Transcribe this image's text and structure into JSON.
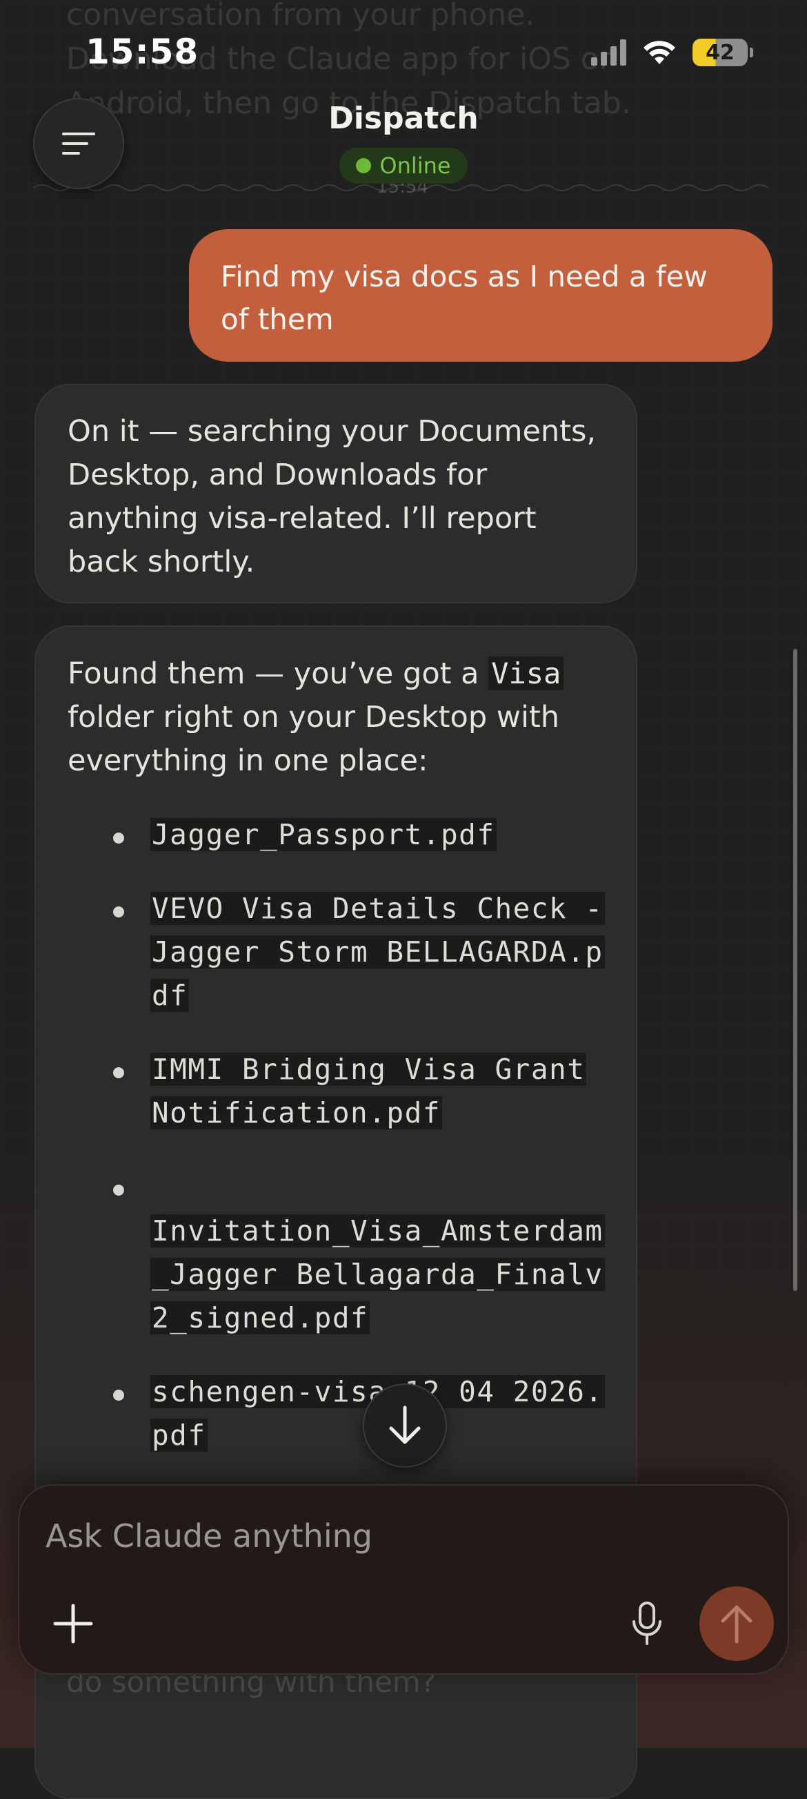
{
  "status_bar": {
    "time": "15:58",
    "battery": "42"
  },
  "background": {
    "ghost_lines": [
      "conversation from your phone.",
      "Download the Claude app for iOS or",
      "Android, then go to the Dispatch tab."
    ],
    "ghost_time": "15:54",
    "ghost_bottom": "do something with them?"
  },
  "header": {
    "title": "Dispatch",
    "status": "Online"
  },
  "messages": {
    "user_1": "Find my visa docs as I need a few of them",
    "assistant_1": "On it — searching your Documents, Desktop, and Downloads for anything visa-related. I’ll report back shortly.",
    "assistant_2": {
      "intro_pre": "Found them — you’ve got a ",
      "intro_code": "Visa",
      "intro_post": " folder right on your Desktop with everything in one place:",
      "files": [
        "Jagger_Passport.pdf",
        "VEVO Visa Details Check - Jagger Storm BELLAGARDA.pdf",
        "IMMI Bridging Visa Grant Notification.pdf",
        "Invitation_Visa_Amsterdam_Jagger Bellagarda_Finalv2_signed.pdf",
        "schengen-visa 12 04 2026.pdf"
      ]
    }
  },
  "composer": {
    "placeholder": "Ask Claude anything"
  },
  "colors": {
    "background": "#202020",
    "user_bubble": "#c45f3e",
    "assistant_bubble": "#2c2c2c",
    "online_green": "#6fb83c",
    "send_button": "#7c3a27"
  },
  "icons": {
    "menu": "menu-icon",
    "scroll_down": "arrow-down-icon",
    "plus": "plus-icon",
    "mic": "microphone-icon",
    "send": "arrow-up-icon"
  }
}
